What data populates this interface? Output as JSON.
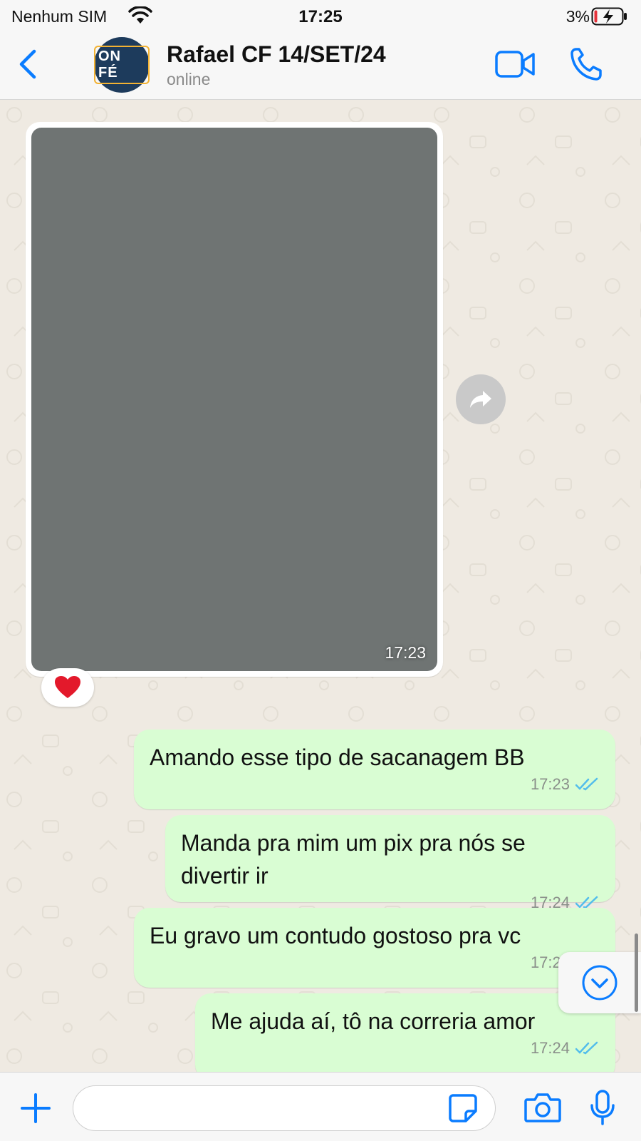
{
  "status_bar": {
    "carrier": "Nenhum SIM",
    "time": "17:25",
    "battery": "3%"
  },
  "header": {
    "contact_name": "Rafael CF 14/SET/24",
    "contact_status": "online",
    "avatar_text": "ON FÉ"
  },
  "chat": {
    "image_message": {
      "time": "17:23",
      "reaction": "❤️"
    },
    "messages": [
      {
        "text": "Amando esse tipo de sacanagem BB",
        "time": "17:23",
        "status": "read"
      },
      {
        "text": "Manda pra mim um pix pra nós se divertir ir",
        "time": "17:24",
        "status": "read"
      },
      {
        "text": "Eu gravo um contudo gostoso pra vc",
        "time": "17:24",
        "status": "read"
      },
      {
        "text": "Me ajuda aí, tô na correria amor",
        "time": "17:24",
        "status": "read"
      }
    ]
  },
  "colors": {
    "accent": "#0a7cff",
    "outgoing_bubble": "#d9fdd3",
    "read_ticks": "#53bdeb",
    "chat_background": "#efeae2"
  },
  "icons": [
    "wifi-icon",
    "battery-icon",
    "back-icon",
    "video-call-icon",
    "phone-icon",
    "forward-icon",
    "chevron-down-icon",
    "plus-icon",
    "sticker-icon",
    "camera-icon",
    "mic-icon"
  ]
}
